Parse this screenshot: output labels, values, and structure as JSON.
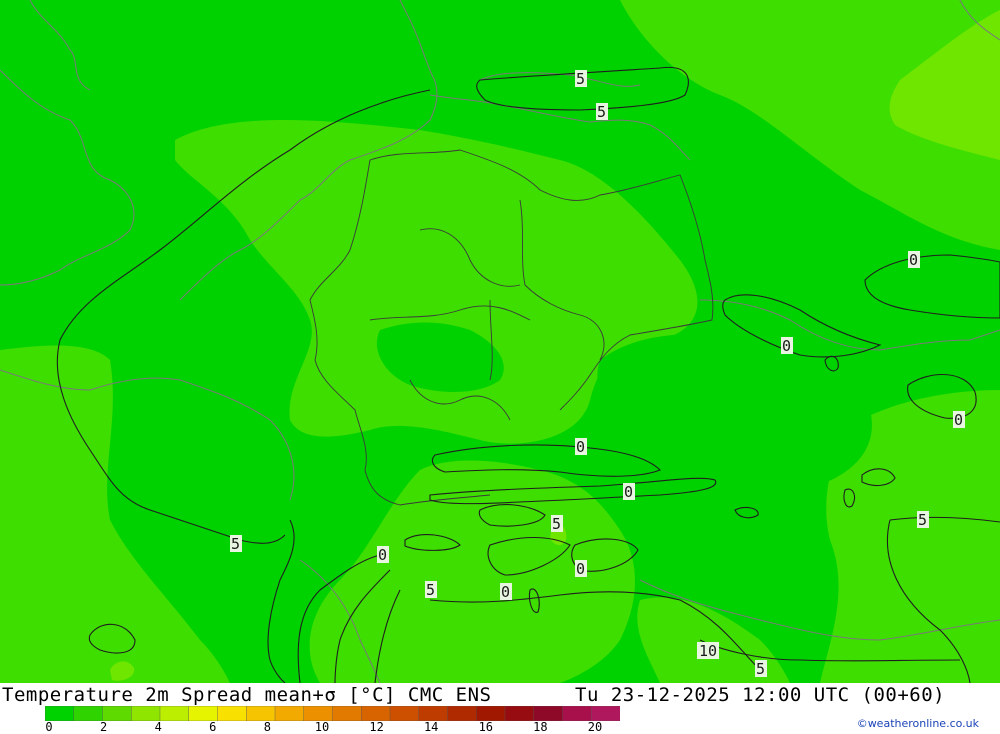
{
  "title": "Temperature 2m Spread mean+σ [°C] CMC ENS",
  "datetime": "Tu 23-12-2025 12:00 UTC (00+60)",
  "credit": "©weatheronline.co.uk",
  "legend": {
    "ticks": [
      "0",
      "2",
      "4",
      "6",
      "8",
      "10",
      "12",
      "14",
      "16",
      "18",
      "20"
    ],
    "colors": [
      "#00d200",
      "#2fd400",
      "#5fda00",
      "#8fe400",
      "#bbee00",
      "#e6f400",
      "#f8e000",
      "#f6c400",
      "#f2aa00",
      "#ec9000",
      "#e27a00",
      "#d86400",
      "#cc5000",
      "#bf3c00",
      "#b02a00",
      "#a01800",
      "#960c10",
      "#8e0828",
      "#a8104c",
      "#b0185e"
    ]
  },
  "contour_labels": [
    {
      "text": "5",
      "name": "label-5-north-a"
    },
    {
      "text": "5",
      "name": "label-5-north-b"
    },
    {
      "text": "0",
      "name": "label-0-east-a"
    },
    {
      "text": "0",
      "name": "label-0-east-b"
    },
    {
      "text": "0",
      "name": "label-0-east-c"
    },
    {
      "text": "0",
      "name": "label-0-central"
    },
    {
      "text": "0",
      "name": "label-0-south-a"
    },
    {
      "text": "5",
      "name": "label-5-alps-a"
    },
    {
      "text": "5",
      "name": "label-5-west"
    },
    {
      "text": "0",
      "name": "label-0-alps-a"
    },
    {
      "text": "5",
      "name": "label-5-alps-b"
    },
    {
      "text": "0",
      "name": "label-0-alps-b"
    },
    {
      "text": "0",
      "name": "label-0-alps-c"
    },
    {
      "text": "5",
      "name": "label-5-southeast"
    },
    {
      "text": "10",
      "name": "label-10-balkan"
    },
    {
      "text": "5",
      "name": "label-5-balkan"
    }
  ],
  "colors": {
    "base_green": "#00d200",
    "light_green": "#3ede00",
    "lime_green": "#6ee600",
    "contour_line": "#1f1f1f",
    "border_line": "#7a7a7a"
  }
}
